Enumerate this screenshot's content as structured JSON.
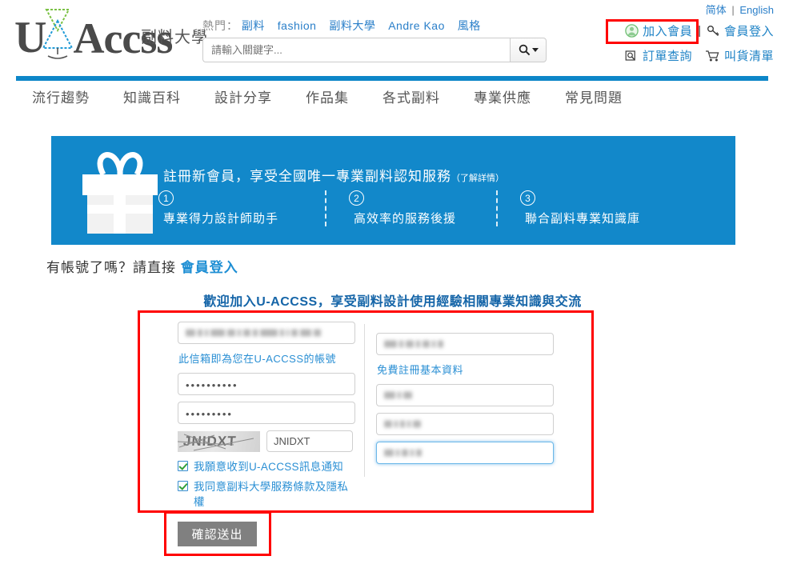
{
  "header": {
    "logo": {
      "u": "U",
      "accss": "Accss",
      "cn": "副料大學",
      "glyph_colors": [
        "#7ac143",
        "#1f9ad6"
      ]
    },
    "hot": {
      "label": "熱門：",
      "links": [
        "副料",
        "fashion",
        "副料大學",
        "Andre Kao",
        "風格"
      ]
    },
    "search": {
      "placeholder": "請輸入關鍵字...",
      "value": "",
      "button_icon": "search-icon"
    },
    "lang": {
      "simplified": "简体",
      "separator": "|",
      "english": "English"
    },
    "account": {
      "join": "加入會員",
      "divider": "|",
      "login": "會員登入",
      "order_query": "訂單查詢",
      "cart": "叫貨清單"
    }
  },
  "nav": {
    "items": [
      "流行趨勢",
      "知識百科",
      "設計分享",
      "作品集",
      "各式副料",
      "專業供應",
      "常見問題"
    ]
  },
  "banner": {
    "bg_color": "#1288ca",
    "headline": "註冊新會員，享受全國唯一專業副料認知服務",
    "headline_link": "（了解詳情）",
    "features": [
      {
        "num": "1",
        "text": "專業得力設計師助手"
      },
      {
        "num": "2",
        "text": "高效率的服務後援"
      },
      {
        "num": "3",
        "text": "聯合副料專業知識庫"
      }
    ]
  },
  "have_account": {
    "text": "有帳號了嗎？請直接",
    "link": "會員登入"
  },
  "form": {
    "welcome": "歡迎加入U-ACCSS，享受副料設計使用經驗相關專業知識與交流",
    "left": {
      "email": {
        "value": "",
        "redacted": true,
        "redact_widths": [
          12,
          6,
          4,
          18,
          10,
          4,
          9,
          6,
          22,
          5,
          3,
          8,
          14,
          9
        ]
      },
      "email_hint": "此信箱即為您在U-ACCSS的帳號",
      "password": {
        "value": "••••••••••"
      },
      "password_confirm": {
        "value": "•••••••••"
      },
      "captcha_image_text": "JNIDXT",
      "captcha_input_value": "JNIDXT",
      "checkboxes": [
        {
          "label": "我願意收到U-ACCSS訊息通知",
          "checked": true
        },
        {
          "label": "我同意副料大學服務條款及隱私權",
          "checked": true
        }
      ]
    },
    "right": {
      "name": {
        "value": "",
        "redacted": true,
        "redact_widths": [
          16,
          5,
          10,
          5,
          9,
          4,
          7
        ]
      },
      "hint": "免費註冊基本資料",
      "field2": {
        "value": "",
        "redacted": true,
        "redact_widths": [
          14,
          4,
          11
        ]
      },
      "field3": {
        "value": "",
        "redacted": true,
        "redact_widths": [
          10,
          4,
          6,
          4,
          10
        ]
      },
      "field4": {
        "value": "",
        "redacted": true,
        "focused": true,
        "redact_widths": [
          12,
          4,
          8,
          4,
          7
        ]
      }
    },
    "submit_label": "確認送出",
    "highlight_color": "#ff0000"
  }
}
